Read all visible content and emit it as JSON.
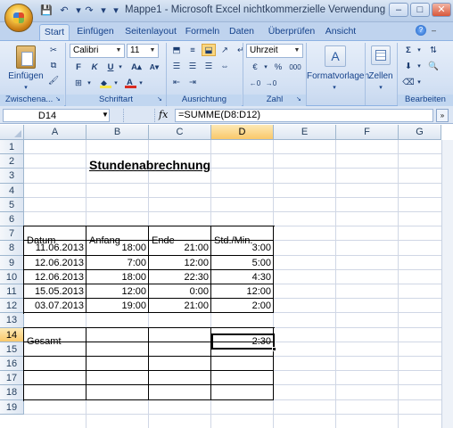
{
  "window": {
    "title": "Mappe1 - Microsoft Excel nichtkommerzielle Verwendung",
    "buttons": {
      "minimize": "–",
      "maximize": "□",
      "close": "✕"
    }
  },
  "quick_access": {
    "save": "💾",
    "undo": "↶",
    "redo": "↷",
    "customize": "▾"
  },
  "tabs": [
    {
      "label": "Start",
      "active": true
    },
    {
      "label": "Einfügen"
    },
    {
      "label": "Seitenlayout"
    },
    {
      "label": "Formeln"
    },
    {
      "label": "Daten"
    },
    {
      "label": "Überprüfen"
    },
    {
      "label": "Ansicht"
    }
  ],
  "ribbon": {
    "clipboard": {
      "paste_label": "Einfügen",
      "group_label": "Zwischena..."
    },
    "font": {
      "family": "Calibri",
      "size": "11",
      "bold": "F",
      "italic": "K",
      "underline": "U",
      "grow": "A▴",
      "shrink": "A▾",
      "group_label": "Schriftart",
      "fill_color": "#f7e64b",
      "font_color": "#d92b20"
    },
    "alignment": {
      "group_label": "Ausrichtung"
    },
    "number": {
      "format": "Uhrzeit",
      "percent": "%",
      "thousands": "000",
      "group_label": "Zahl"
    },
    "styles": {
      "label": "Formatvorlagen"
    },
    "cells": {
      "label": "Zellen"
    },
    "editing": {
      "sum": "Σ",
      "group_label": "Bearbeiten"
    }
  },
  "formula_bar": {
    "name_box": "D14",
    "fx": "fx",
    "formula": "=SUMME(D8:D12)",
    "expand": "»"
  },
  "sheet": {
    "columns": [
      "A",
      "B",
      "C",
      "D",
      "E",
      "F",
      "G"
    ],
    "selected_column": "D",
    "rows": [
      "1",
      "2",
      "3",
      "4",
      "5",
      "6",
      "7",
      "8",
      "9",
      "10",
      "11",
      "12",
      "13",
      "14",
      "15",
      "16",
      "17",
      "18",
      "19"
    ],
    "selected_row": "14",
    "heading": "Stundenabrechnung",
    "table_headers": [
      "Datum",
      "Anfang",
      "Ende",
      "Std./Min."
    ],
    "entries": [
      {
        "date": "11.06.2013",
        "start": "18:00",
        "end": "21:00",
        "hours": "3:00"
      },
      {
        "date": "12.06.2013",
        "start": "7:00",
        "end": "12:00",
        "hours": "5:00"
      },
      {
        "date": "12.06.2013",
        "start": "18:00",
        "end": "22:30",
        "hours": "4:30"
      },
      {
        "date": "15.05.2013",
        "start": "12:00",
        "end": "0:00",
        "hours": "12:00"
      },
      {
        "date": "03.07.2013",
        "start": "19:00",
        "end": "21:00",
        "hours": "2:00"
      }
    ],
    "total_label": "Gesamt",
    "total_value": "2:30"
  }
}
